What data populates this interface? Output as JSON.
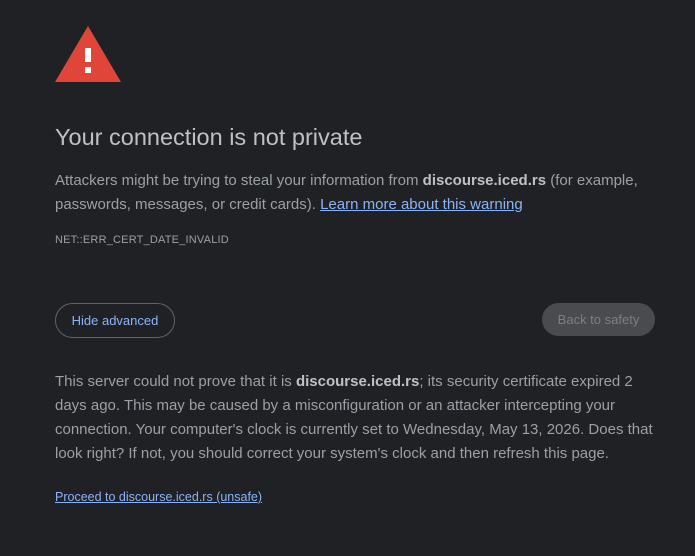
{
  "page": {
    "title": "Your connection is not private",
    "intro": {
      "before": "Attackers might be trying to steal your information from ",
      "domain": "discourse.iced.rs",
      "after": " (for example, passwords, messages, or credit cards). ",
      "learn_more": "Learn more about this warning"
    },
    "error_code": "NET::ERR_CERT_DATE_INVALID",
    "buttons": {
      "hide_advanced": "Hide advanced",
      "back_to_safety": "Back to safety"
    },
    "details": {
      "before": "This server could not prove that it is ",
      "domain": "discourse.iced.rs",
      "after": "; its security certificate expired 2 days ago. This may be caused by a misconfiguration or an attacker intercepting your connection. Your computer's clock is currently set to Wednesday, May 13, 2026. Does that look right? If not, you should correct your system's clock and then refresh this page."
    },
    "proceed_link": "Proceed to discourse.iced.rs (unsafe)"
  },
  "icons": {
    "warning": "warning-triangle-icon"
  },
  "colors": {
    "background": "#202124",
    "warning_red": "#e0453a",
    "link_blue": "#8ab4f8",
    "text": "#9aa0a6",
    "heading": "#bdc1c6"
  }
}
